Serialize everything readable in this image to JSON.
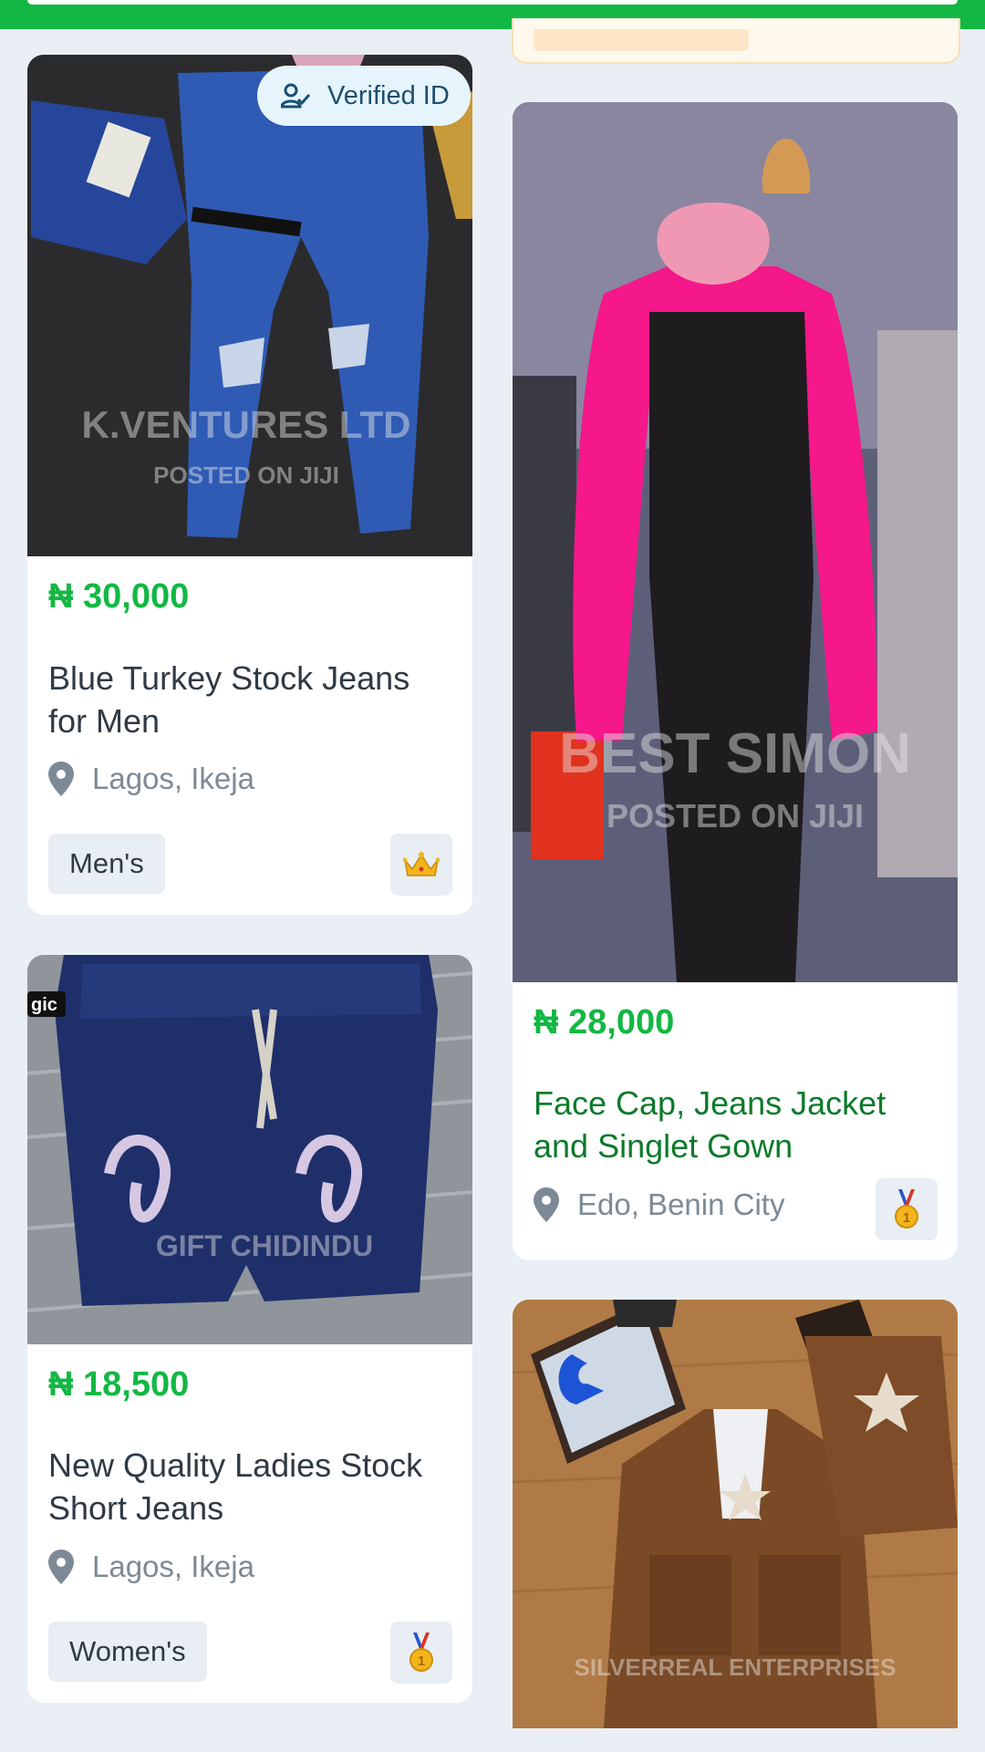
{
  "listings": [
    {
      "price": "₦ 30,000",
      "title": "Blue Turkey Stock Jeans for Men",
      "location": "Lagos, Ikeja",
      "tag": "Men's",
      "verified_label": "Verified ID",
      "badge_icon": "crown-icon",
      "watermark": "K.VENTURES LTD",
      "watermark_sub": "POSTED ON JIJI"
    },
    {
      "price": "₦ 18,500",
      "title": "New Quality Ladies Stock Short Jeans",
      "location": "Lagos, Ikeja",
      "tag": "Women's",
      "badge_icon": "medal-icon",
      "corner_text": "gic",
      "watermark": "GIFT CHIDINDU"
    },
    {
      "price": "₦ 28,000",
      "title": "Face Cap, Jeans Jacket and Singlet Gown",
      "location": "Edo, Benin City",
      "badge_icon": "medal-icon",
      "watermark": "BEST SIMON",
      "watermark_sub": "POSTED ON JIJI"
    },
    {
      "watermark": "SILVERREAL ENTERPRISES"
    }
  ],
  "colors": {
    "brand_green": "#12b843",
    "title_green": "#0d7a2b",
    "page_bg": "#e9eff5"
  }
}
